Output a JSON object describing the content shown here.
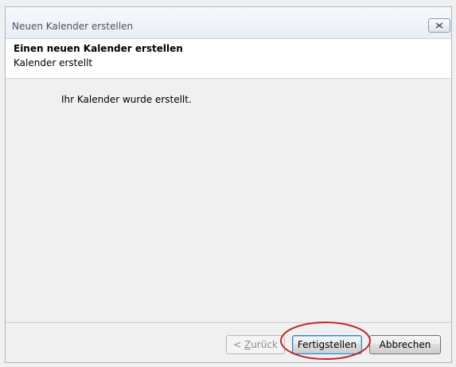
{
  "window": {
    "title": "Neuen Kalender erstellen"
  },
  "header": {
    "title": "Einen neuen Kalender erstellen",
    "subtitle": "Kalender erstellt"
  },
  "content": {
    "message": "Ihr Kalender wurde erstellt."
  },
  "buttons": {
    "back_prefix": "< ",
    "back_mnemonic": "Z",
    "back_rest": "urück",
    "finish": "Fertigstellen",
    "cancel": "Abbrechen"
  },
  "annotation": {
    "highlight_color": "#c0282d"
  },
  "icons": {
    "close": "close-icon"
  }
}
